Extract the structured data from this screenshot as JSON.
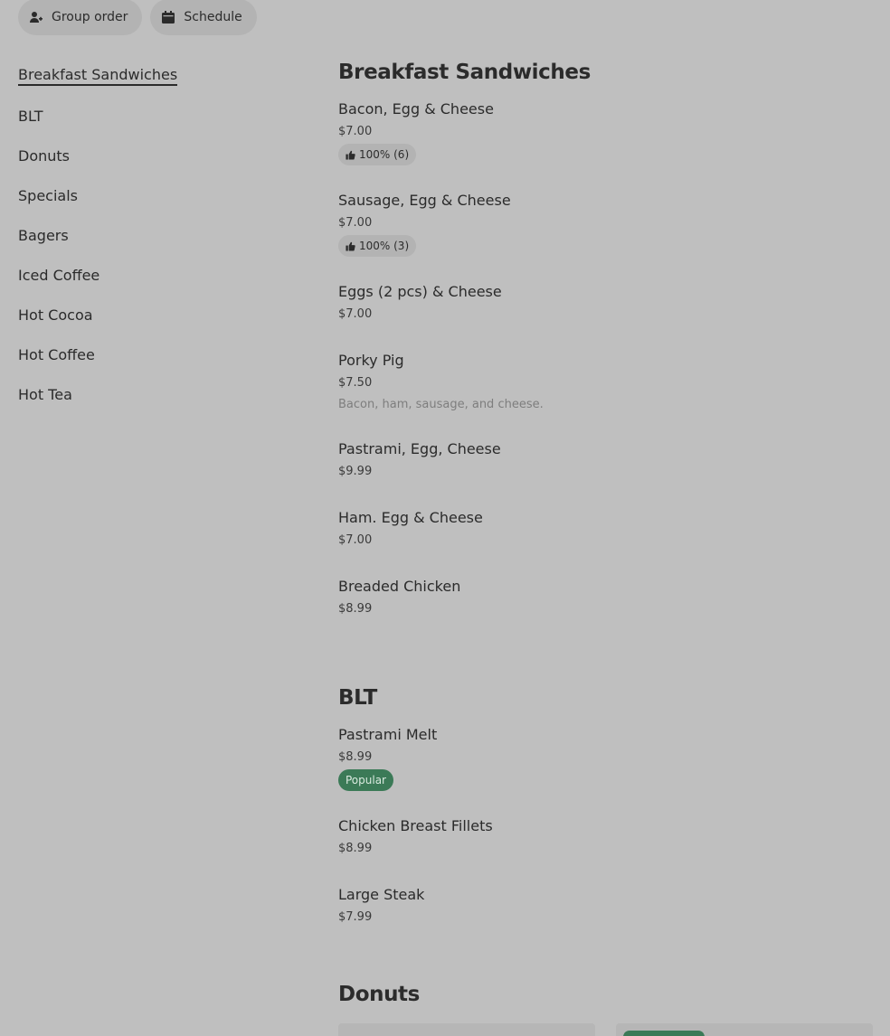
{
  "topbar": {
    "group_order_label": "Group order",
    "schedule_label": "Schedule"
  },
  "sidebar": {
    "items": [
      {
        "label": "Breakfast Sandwiches",
        "active": true
      },
      {
        "label": "BLT"
      },
      {
        "label": "Donuts"
      },
      {
        "label": "Specials"
      },
      {
        "label": "Bagers"
      },
      {
        "label": "Iced Coffee"
      },
      {
        "label": "Hot Cocoa"
      },
      {
        "label": "Hot Coffee"
      },
      {
        "label": "Hot Tea"
      }
    ]
  },
  "sections": {
    "breakfast": {
      "title": "Breakfast Sandwiches",
      "items": [
        {
          "name": "Bacon, Egg & Cheese",
          "price": "$7.00",
          "rating": "100% (6)"
        },
        {
          "name": "Sausage, Egg & Cheese",
          "price": "$7.00",
          "rating": "100% (3)"
        },
        {
          "name": "Eggs (2 pcs) & Cheese",
          "price": "$7.00"
        },
        {
          "name": "Porky Pig",
          "price": "$7.50",
          "description": "Bacon, ham, sausage, and cheese."
        },
        {
          "name": "Pastrami, Egg, Cheese",
          "price": "$9.99"
        },
        {
          "name": "Ham. Egg & Cheese",
          "price": "$7.00"
        },
        {
          "name": "Breaded Chicken",
          "price": "$8.99"
        }
      ]
    },
    "blt": {
      "title": "BLT",
      "items": [
        {
          "name": "Pastrami Melt",
          "price": "$8.99",
          "badge": "Popular"
        },
        {
          "name": "Chicken Breast Fillets",
          "price": "$8.99"
        },
        {
          "name": "Large Steak",
          "price": "$7.99"
        }
      ]
    },
    "donuts": {
      "title": "Donuts"
    }
  },
  "colors": {
    "background": "#bfbfbf",
    "pill": "#b3b3b3",
    "popular_badge": "#3b7a57",
    "text": "#2b2b2b"
  },
  "icons": {
    "group_order": "person-plus-icon",
    "schedule": "calendar-icon",
    "rating": "thumbs-up-icon"
  }
}
